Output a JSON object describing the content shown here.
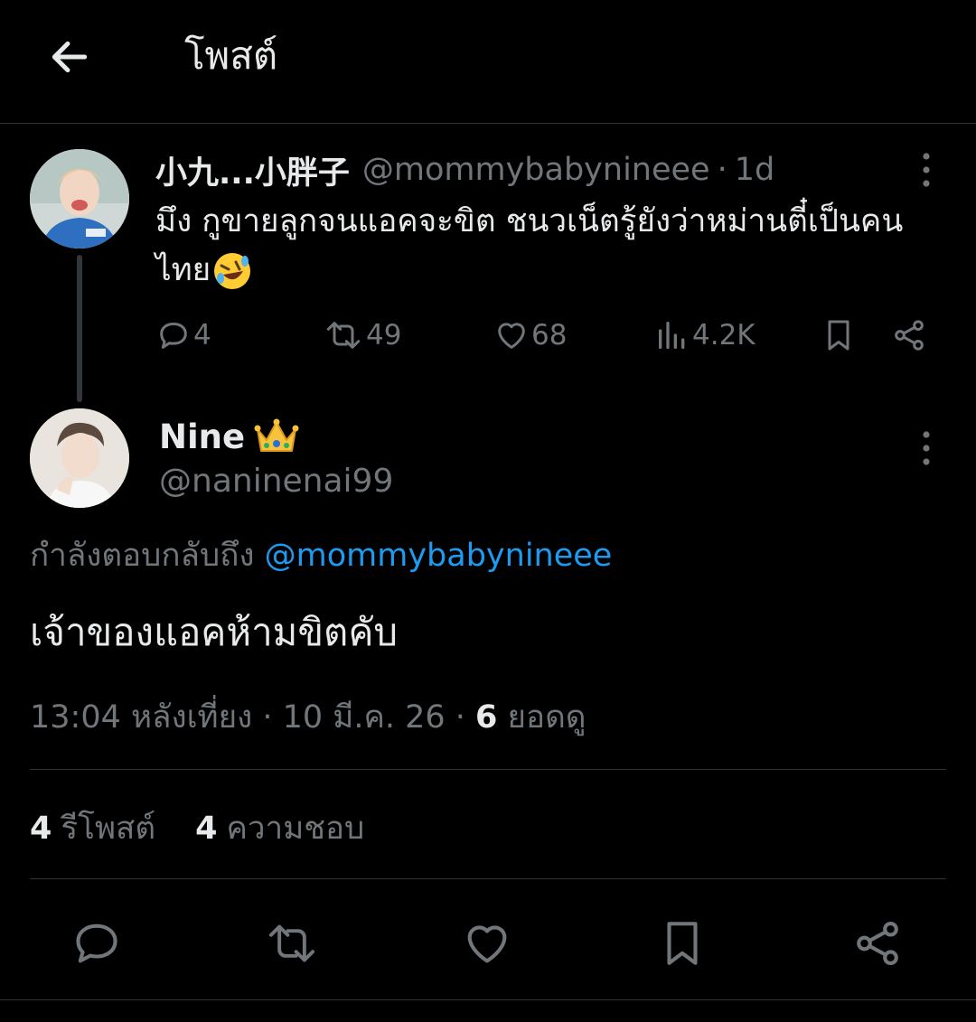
{
  "header": {
    "title": "โพสต์",
    "back_icon": "arrow-left-icon"
  },
  "parent_post": {
    "display_name": "小九...小胖子",
    "handle": "@mommybabynineee",
    "separator": "·",
    "time": "1d",
    "text": "มึง กูขายลูกจนแอคจะขิต ชนวเน็ตรู้ยังว่าหม่านตี๋เป็นคนไทย",
    "text_emoji": "rolling-on-floor-laughing-emoji",
    "actions": {
      "replies": "4",
      "reposts": "49",
      "likes": "68",
      "views": "4.2K"
    }
  },
  "reply_post": {
    "display_name": "Nine",
    "name_emoji": "crown-emoji",
    "handle": "@naninenai99",
    "replying_prefix": "กำลังตอบกลับถึง",
    "replying_to": "@mommybabynineee",
    "text": "เจ้าของแอคห้ามขิตคับ",
    "timestamp": "13:04 หลังเที่ยง · 10 มี.ค. 26 · ",
    "views_count": "6",
    "views_label": "ยอดดู",
    "reposts_count": "4",
    "reposts_label": "รีโพสต์",
    "likes_count": "4",
    "likes_label": "ความชอบ"
  },
  "colors": {
    "background": "#000000",
    "text": "#e7e9ea",
    "secondary": "#71767b",
    "accent": "#1d9bf0",
    "divider": "#2f3336"
  }
}
